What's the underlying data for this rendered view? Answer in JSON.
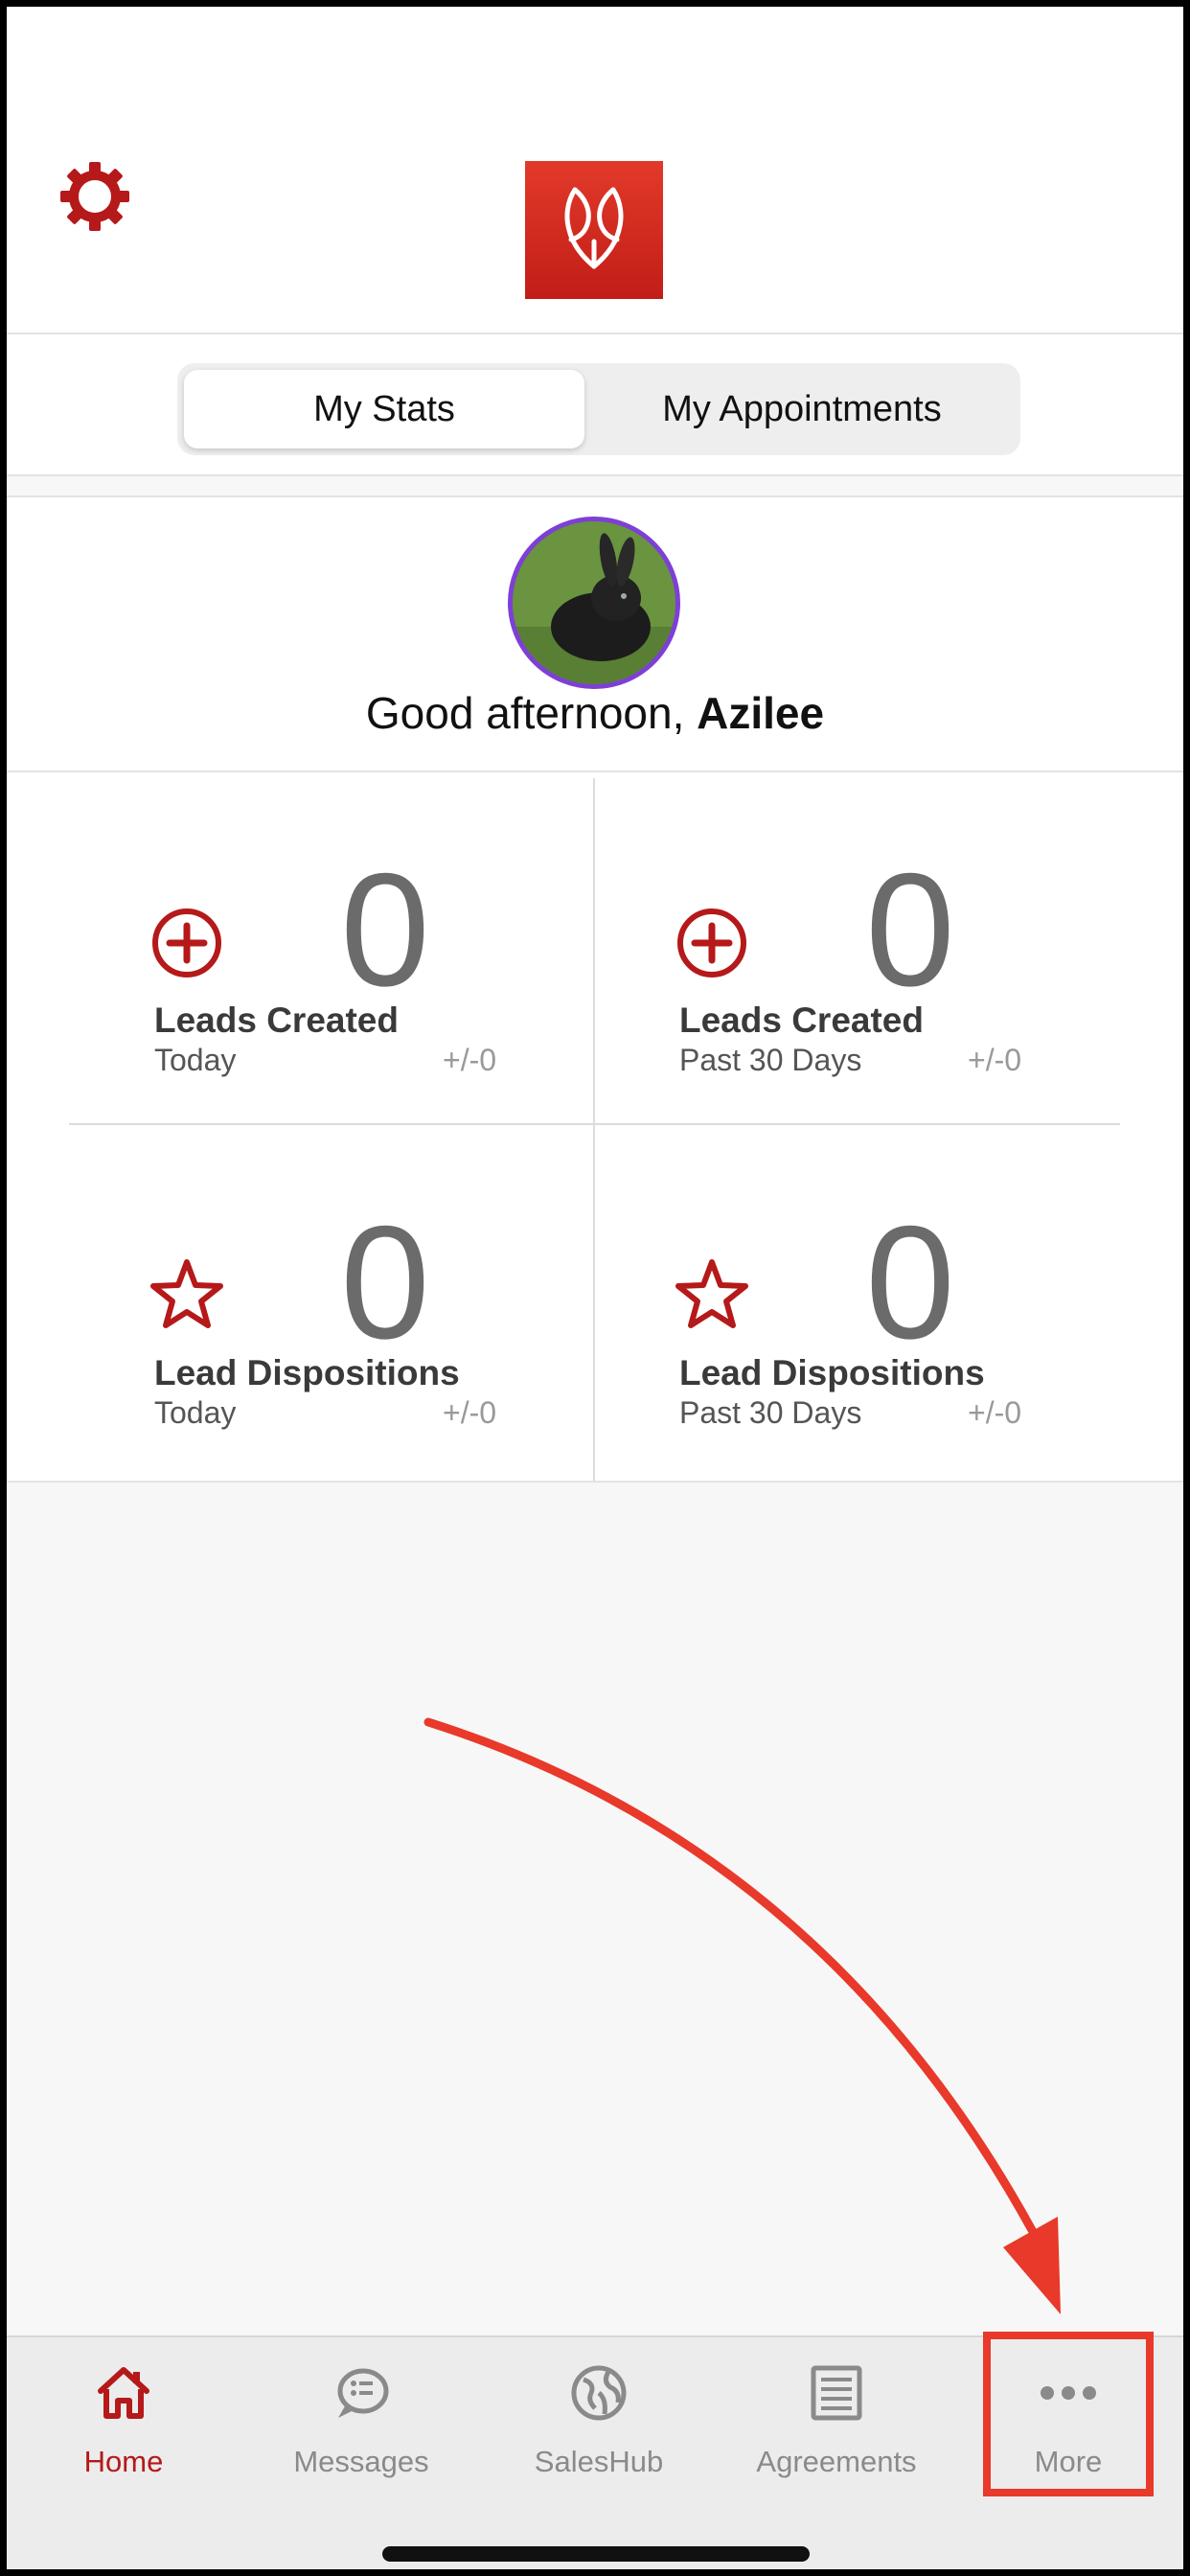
{
  "header": {
    "settings_icon": "gear-icon",
    "logo_icon": "brand-logo-icon"
  },
  "segmented_control": {
    "active_label": "My Stats",
    "inactive_label": "My Appointments"
  },
  "profile": {
    "greeting_prefix": "Good afternoon, ",
    "user_name": "Azilee",
    "avatar_icon": "rabbit-avatar"
  },
  "stats": [
    {
      "value": "0",
      "title": "Leads Created",
      "period": "Today",
      "delta": "+/-0",
      "icon": "plus-circle-icon"
    },
    {
      "value": "0",
      "title": "Leads Created",
      "period": "Past 30 Days",
      "delta": "+/-0",
      "icon": "plus-circle-icon"
    },
    {
      "value": "0",
      "title": "Lead Dispositions",
      "period": "Today",
      "delta": "+/-0",
      "icon": "star-icon"
    },
    {
      "value": "0",
      "title": "Lead Dispositions",
      "period": "Past 30 Days",
      "delta": "+/-0",
      "icon": "star-icon"
    }
  ],
  "tabbar": {
    "items": [
      {
        "label": "Home",
        "icon": "home-icon",
        "active": true
      },
      {
        "label": "Messages",
        "icon": "chat-bubble-icon",
        "active": false
      },
      {
        "label": "SalesHub",
        "icon": "globe-icon",
        "active": false
      },
      {
        "label": "Agreements",
        "icon": "document-icon",
        "active": false
      },
      {
        "label": "More",
        "icon": "more-dots-icon",
        "active": false
      }
    ]
  },
  "colors": {
    "brand_red": "#b5191a",
    "annotation_red": "#e8392a",
    "avatar_ring": "#7e3fd6"
  }
}
